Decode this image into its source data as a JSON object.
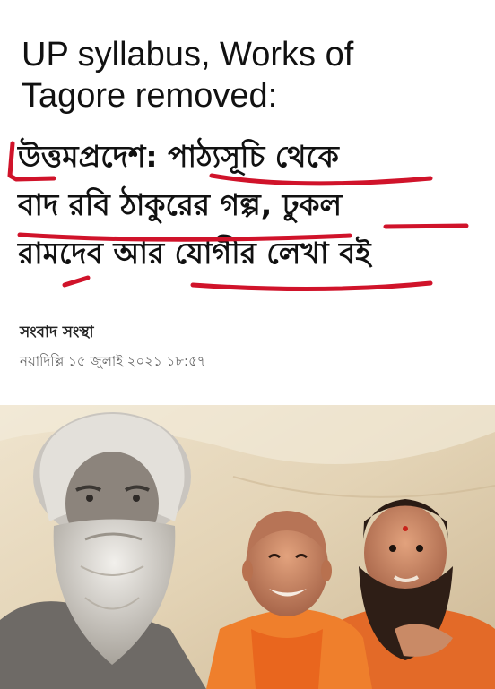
{
  "headline_en": {
    "line1": "UP syllabus, Works of",
    "line2": "Tagore removed:"
  },
  "headline_bn": {
    "line1": "উত্তমপ্রদেশ: পাঠ্যসূচি থেকে",
    "line2": "বাদ রবি ঠাকুরের গল্প, ঢুকল",
    "line3": "রামদেব আর যোগীর লেখা বই"
  },
  "byline": "সংবাদ সংস্থা",
  "dateline": "নয়াদিল্লি ১৫ জুলাই ২০২১ ১৮:৫৭",
  "colors": {
    "underline": "#d0132a",
    "saffron": "#e8742a",
    "background_photo": "#e9dcc4"
  },
  "photo": {
    "subjects": [
      "portrait-left-elder",
      "portrait-center-saffron",
      "portrait-right-bearded"
    ]
  }
}
